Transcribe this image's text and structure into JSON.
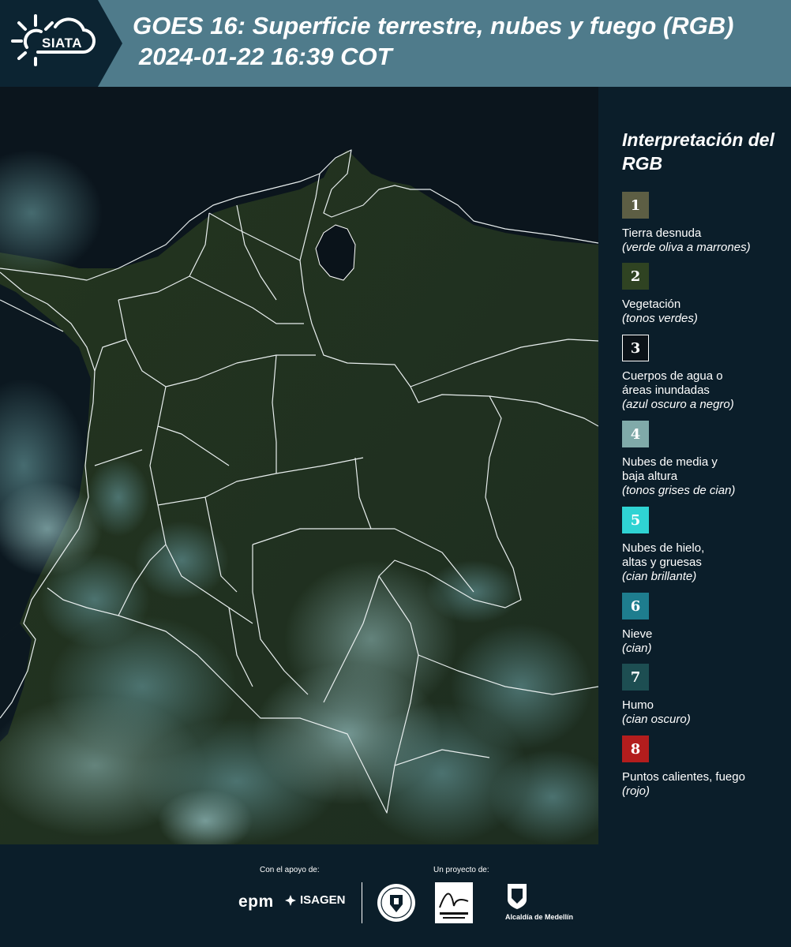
{
  "header": {
    "logo_text": "SIATA",
    "title": "GOES 16: Superficie terrestre, nubes y fuego (RGB)",
    "datetime": "2024-01-22 16:39 COT"
  },
  "legend": {
    "title": "Interpretación del RGB",
    "items": [
      {
        "number": "1",
        "label": "Tierra desnuda",
        "desc": "(verde oliva a marrones)",
        "color": "#5d5e44"
      },
      {
        "number": "2",
        "label": "Vegetación",
        "desc": "(tonos verdes)",
        "color": "#2f4322"
      },
      {
        "number": "3",
        "label": "Cuerpos de agua o áreas inundadas",
        "desc": "(azul oscuro a negro)",
        "color": "#0b1218"
      },
      {
        "number": "4",
        "label": "Nubes de media y baja altura",
        "desc": "(tonos grises de cian)",
        "color": "#80aaa9"
      },
      {
        "number": "5",
        "label": "Nubes de hielo, altas y gruesas",
        "desc": "(cian brillante)",
        "color": "#2fd3d3"
      },
      {
        "number": "6",
        "label": "Nieve",
        "desc": "(cian)",
        "color": "#1e7d8e"
      },
      {
        "number": "7",
        "label": "Humo",
        "desc": "(cian oscuro)",
        "color": "#1d4e52"
      },
      {
        "number": "8",
        "label": "Puntos calientes, fuego",
        "desc": "(rojo)",
        "color": "#b31d1d"
      }
    ]
  },
  "footer": {
    "support_label": "Con el apoyo de:",
    "project_label": "Un proyecto de:",
    "epm": "epm",
    "isagen": "ISAGEN",
    "alcaldia": "Alcaldía de Medellín"
  }
}
